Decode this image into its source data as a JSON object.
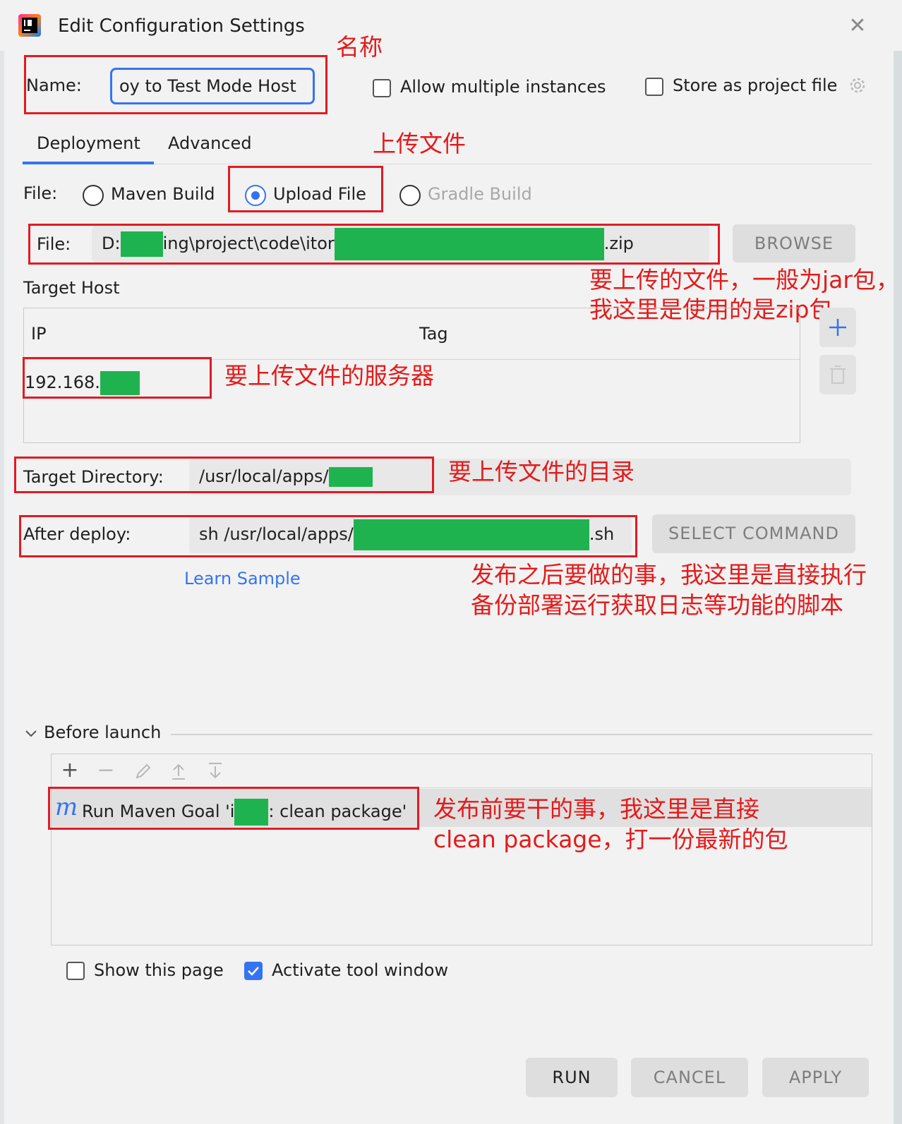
{
  "window": {
    "title": "Edit Configuration Settings"
  },
  "name_row": {
    "label": "Name:",
    "value": "oy to Test Mode Host",
    "allow_multiple": "Allow multiple instances",
    "allow_multiple_checked": false,
    "store_project": "Store as project file",
    "store_project_checked": false
  },
  "tabs": [
    {
      "label": "Deployment",
      "active": true
    },
    {
      "label": "Advanced",
      "active": false
    }
  ],
  "file_type": {
    "label": "File:",
    "options": [
      {
        "label": "Maven Build",
        "selected": false,
        "disabled": false
      },
      {
        "label": "Upload File",
        "selected": true,
        "disabled": false
      },
      {
        "label": "Gradle Build",
        "selected": false,
        "disabled": true
      }
    ]
  },
  "file_row": {
    "label": "File:",
    "value_start": "D:",
    "value_mid": "ing\\project\\code\\itor",
    "value_end": ".zip",
    "browse": "BROWSE"
  },
  "target_host": {
    "label": "Target Host",
    "columns": [
      "IP",
      "Tag"
    ],
    "rows": [
      {
        "ip": "192.168.",
        "tag": ""
      }
    ]
  },
  "target_dir": {
    "label": "Target Directory:",
    "value": "/usr/local/apps/"
  },
  "after_deploy": {
    "label": "After deploy:",
    "value_start": "sh /usr/local/apps/",
    "value_end": ".sh",
    "select_command": "SELECT COMMAND",
    "learn_sample": "Learn Sample"
  },
  "before_launch": {
    "label": "Before launch",
    "tasks": [
      {
        "prefix": "Run Maven Goal 'i",
        "suffix": ": clean package'"
      }
    ]
  },
  "options": {
    "show_page": "Show this page",
    "show_page_checked": false,
    "activate_tool": "Activate tool window",
    "activate_tool_checked": true
  },
  "footer": {
    "run": "RUN",
    "cancel": "CANCEL",
    "apply": "APPLY"
  },
  "annotations": {
    "name": "名称",
    "upload_file": "上传文件",
    "file_line1": "要上传的文件，一般为jar包，",
    "file_line2": "我这里是使用的是zip包",
    "server": "要上传文件的服务器",
    "directory": "要上传文件的目录",
    "after_line1": "发布之后要做的事，我这里是直接执行",
    "after_line2": "备份部署运行获取日志等功能的脚本",
    "before_line1": "发布前要干的事，我这里是直接",
    "before_line2": "clean package，打一份最新的包"
  },
  "colors": {
    "accent": "#3574f0",
    "annotation_red": "#e31b1b",
    "redaction_green": "#1fb350"
  }
}
